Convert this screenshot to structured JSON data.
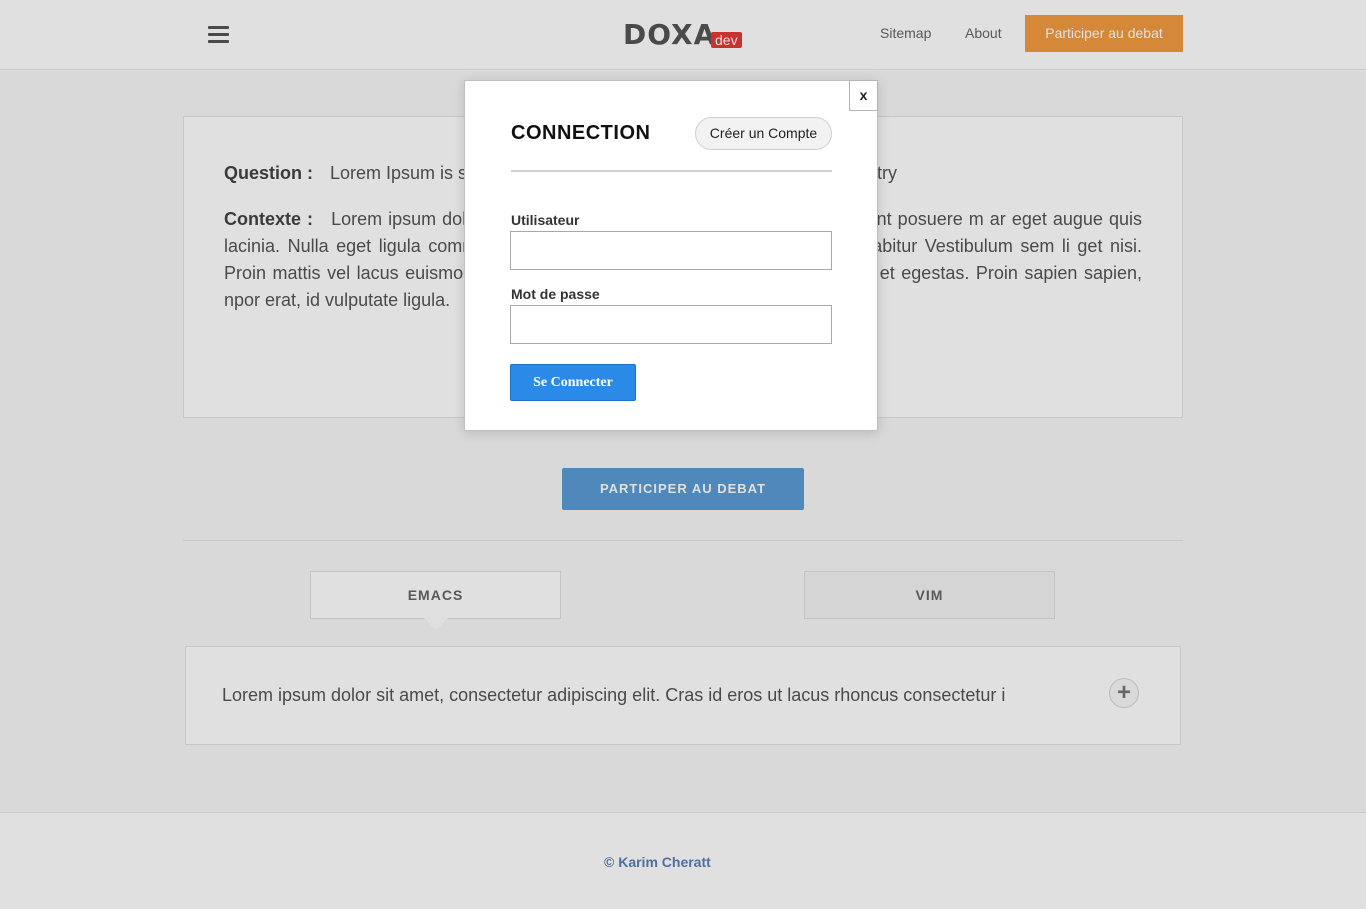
{
  "header": {
    "logo": "DOXA",
    "badge": "dev",
    "nav": {
      "sitemap": "Sitemap",
      "about": "About"
    },
    "participate_button": "Participer au debat",
    "icons": {
      "menu": "hamburger-menu-icon"
    }
  },
  "question": {
    "label": "Question :",
    "text": "Lorem Ipsum is s",
    "text_tail": "dustry"
  },
  "context": {
    "label": "Contexte :",
    "text": "Lorem ipsum dol                                                         s ut lacus rhoncus consectetur id non nisl. Praesent posuere m                                                      ar eget augue quis lacinia. Nulla eget ligula commodo, iaculis                                                     ntum neque, vitae sagittis sem. Curabitur Vestibulum sem li                                                        get nisi. Proin mattis vel lacus euismod fringilla. Nullam eu                                                       erdiet. Vivamus porta ut ante et egestas. Proin sapien sapien,                                                    npor erat, id vulputate ligula."
  },
  "main": {
    "participate_button": "PARTICIPER AU DEBAT",
    "tabs": [
      {
        "label": "EMACS",
        "active": true
      },
      {
        "label": "VIM",
        "active": false
      }
    ],
    "argument_text": "Lorem ipsum dolor sit amet, consectetur adipiscing elit. Cras id eros ut lacus rhoncus consectetur i",
    "add_icon": "plus-icon",
    "add_symbol": "+"
  },
  "footer": {
    "copyright": "© Karim Cheratt"
  },
  "modal": {
    "close_label": "x",
    "title": "CONNECTION",
    "create_account_button": "Créer un Compte",
    "username_label": "Utilisateur",
    "username_value": "",
    "password_label": "Mot de passe",
    "password_value": "",
    "login_button": "Se Connecter"
  },
  "colors": {
    "accent_orange": "#f39c40",
    "accent_blue": "#2b8ae8",
    "badge_red": "#e53935"
  }
}
